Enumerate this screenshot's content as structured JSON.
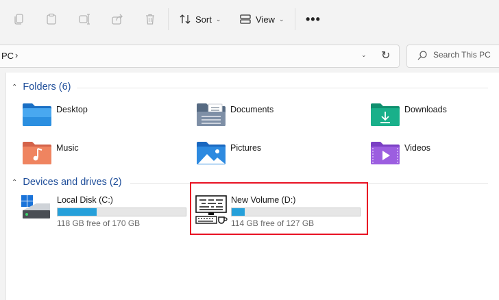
{
  "toolbar": {
    "sort_label": "Sort",
    "view_label": "View",
    "more_label": "•••",
    "icons": [
      "copy-icon",
      "paste-icon",
      "rename-icon",
      "share-icon",
      "delete-icon"
    ]
  },
  "address": {
    "path_text": "PC",
    "separator": "›",
    "search_placeholder": "Search This PC"
  },
  "folders_group": {
    "title": "Folders (6)",
    "items": [
      {
        "label": "Desktop",
        "icon": "desktop-folder-icon"
      },
      {
        "label": "Documents",
        "icon": "documents-folder-icon"
      },
      {
        "label": "Downloads",
        "icon": "downloads-folder-icon"
      },
      {
        "label": "Music",
        "icon": "music-folder-icon"
      },
      {
        "label": "Pictures",
        "icon": "pictures-folder-icon"
      },
      {
        "label": "Videos",
        "icon": "videos-folder-icon"
      }
    ]
  },
  "devices_group": {
    "title": "Devices and drives (2)",
    "drives": [
      {
        "label": "Local Disk (C:)",
        "free_text": "118 GB free of 170 GB",
        "used_fraction": 0.306,
        "icon": "windows-drive-icon"
      },
      {
        "label": "New Volume (D:)",
        "free_text": "114 GB free of 127 GB",
        "used_fraction": 0.102,
        "icon": "computer-drive-icon"
      }
    ]
  },
  "colors": {
    "accent": "#26a0da",
    "highlight": "#e81123",
    "group_header": "#1f4e9a"
  }
}
